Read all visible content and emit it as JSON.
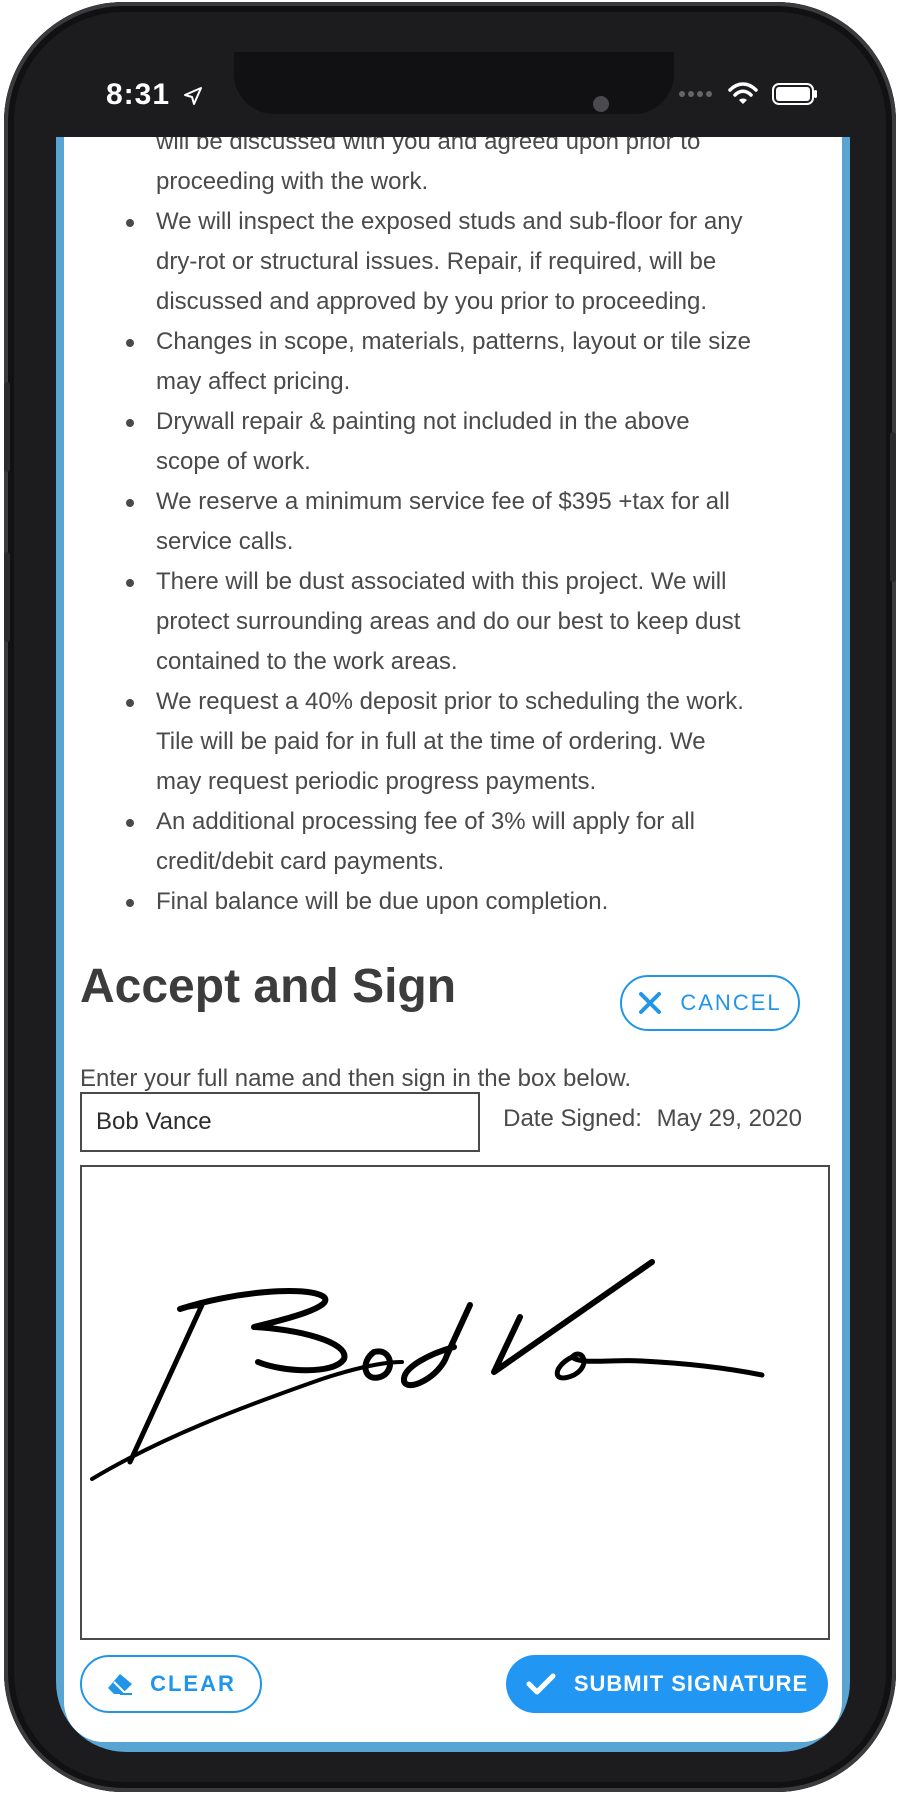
{
  "status_bar": {
    "time": "8:31",
    "icons": [
      "location-arrow-icon",
      "signal-dots-icon",
      "wifi-icon",
      "battery-icon"
    ]
  },
  "terms": [
    {
      "text": "will be discussed with you and agreed upon prior to",
      "bullet": false
    },
    {
      "text": "proceeding with the work.",
      "bullet": false
    },
    {
      "text": "We will inspect the exposed studs and sub-floor for any",
      "bullet": true
    },
    {
      "text": "dry-rot or structural issues. Repair, if required, will be",
      "bullet": false
    },
    {
      "text": "discussed and approved by you prior to proceeding.",
      "bullet": false
    },
    {
      "text": "Changes in scope, materials, patterns, layout or tile size",
      "bullet": true
    },
    {
      "text": "may affect pricing.",
      "bullet": false
    },
    {
      "text": "Drywall repair & painting not included in the above",
      "bullet": true
    },
    {
      "text": "scope of work.",
      "bullet": false
    },
    {
      "text": "We reserve a minimum service fee of $395 +tax for all",
      "bullet": true
    },
    {
      "text": "service calls.",
      "bullet": false
    },
    {
      "text": "There will be dust associated with this project. We will",
      "bullet": true
    },
    {
      "text": "protect surrounding areas and do our best to keep dust",
      "bullet": false
    },
    {
      "text": "contained to the work areas.",
      "bullet": false
    },
    {
      "text": "We request a 40% deposit prior to scheduling the work.",
      "bullet": true
    },
    {
      "text": "Tile will be paid for in full at the time of ordering. We",
      "bullet": false
    },
    {
      "text": "may request periodic progress payments.",
      "bullet": false
    },
    {
      "text": "An additional processing fee of 3% will apply for all",
      "bullet": true
    },
    {
      "text": "credit/debit card payments.",
      "bullet": false
    },
    {
      "text": "Final balance will be due upon completion.",
      "bullet": true
    }
  ],
  "accept": {
    "title": "Accept and Sign",
    "cancel_label": "CANCEL",
    "instructions": "Enter your full name and then sign in the box below.",
    "name_value": "Bob Vance",
    "date_label": "Date Signed:",
    "date_value": "May 29, 2020",
    "signature_text": "Bob Vance"
  },
  "actions": {
    "clear_label": "CLEAR",
    "submit_label": "SUBMIT SIGNATURE"
  },
  "colors": {
    "accent": "#2196f3",
    "frame_blue": "#58a4d2",
    "text": "#4a4a4a",
    "heading": "#3c3c3c"
  }
}
